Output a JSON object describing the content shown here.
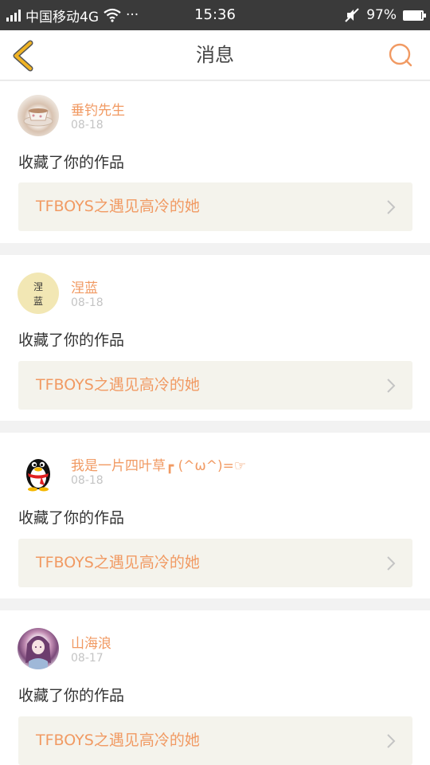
{
  "status_bar": {
    "carrier": "中国移动4G",
    "more": "···",
    "time": "15:36",
    "battery_percent": "97%",
    "battery_level": 0.97
  },
  "nav": {
    "title": "消息",
    "back_icon": "chevron-left-icon",
    "search_icon": "search-icon"
  },
  "colors": {
    "accent": "#f19a63",
    "back_arrow": "#f0b323",
    "work_bg": "#f4f3ec"
  },
  "messages": [
    {
      "name": "垂钓先生",
      "date": "08-18",
      "action": "收藏了你的作品",
      "work_title": "TFBOYS之遇见高冷的她"
    },
    {
      "name": "涅蓝",
      "date": "08-18",
      "action": "收藏了你的作品",
      "work_title": "TFBOYS之遇见高冷的她",
      "avatar_text": "涅蓝"
    },
    {
      "name": "我是一片四叶草┏ (^ω^)=☞",
      "date": "08-18",
      "action": "收藏了你的作品",
      "work_title": "TFBOYS之遇见高冷的她"
    },
    {
      "name": "山海浪",
      "date": "08-17",
      "action": "收藏了你的作品",
      "work_title": "TFBOYS之遇见高冷的她"
    }
  ]
}
